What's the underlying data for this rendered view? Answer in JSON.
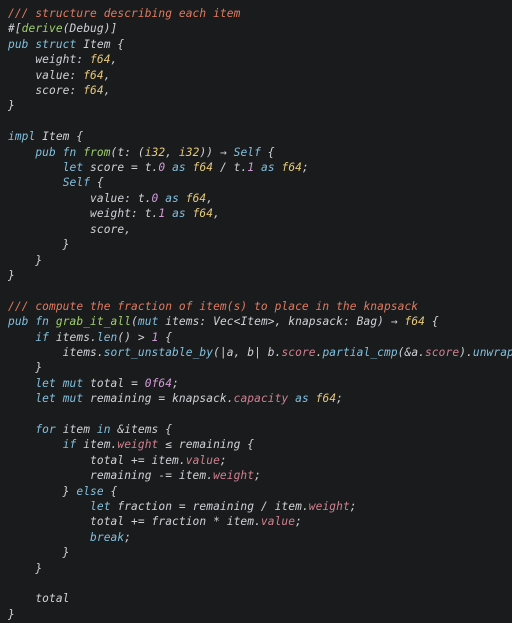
{
  "code": {
    "l1": "/// structure describing each item",
    "l2a": "#[",
    "l2b": "derive",
    "l2c": "(Debug)]",
    "l3a": "pub struct",
    "l3b": " Item {",
    "l4a": "    weight: ",
    "l4b": "f64",
    "l4c": ",",
    "l5a": "    value: ",
    "l5b": "f64",
    "l5c": ",",
    "l6a": "    score: ",
    "l6b": "f64",
    "l6c": ",",
    "l7": "}",
    "l8": "",
    "l9a": "impl",
    "l9b": " Item {",
    "l10a": "    ",
    "l10b": "pub fn",
    "l10c": " ",
    "l10d": "from",
    "l10e": "(t: (",
    "l10f": "i32",
    "l10g": ", ",
    "l10h": "i32",
    "l10i": ")) → ",
    "l10j": "Self",
    "l10k": " {",
    "l11a": "        ",
    "l11b": "let",
    "l11c": " score = t.",
    "l11d": "0",
    "l11e": " ",
    "l11f": "as",
    "l11g": " ",
    "l11h": "f64",
    "l11i": " / t.",
    "l11j": "1",
    "l11k": " ",
    "l11l": "as",
    "l11m": " ",
    "l11n": "f64",
    "l11o": ";",
    "l12a": "        ",
    "l12b": "Self",
    "l12c": " {",
    "l13a": "            value: t.",
    "l13b": "0",
    "l13c": " ",
    "l13d": "as",
    "l13e": " ",
    "l13f": "f64",
    "l13g": ",",
    "l14a": "            weight: t.",
    "l14b": "1",
    "l14c": " ",
    "l14d": "as",
    "l14e": " ",
    "l14f": "f64",
    "l14g": ",",
    "l15": "            score,",
    "l16": "        }",
    "l17": "    }",
    "l18": "}",
    "l19": "",
    "l20": "/// compute the fraction of item(s) to place in the knapsack",
    "l21a": "pub fn",
    "l21b": " ",
    "l21c": "grab_it_all",
    "l21d": "(",
    "l21e": "mut",
    "l21f": " items: Vec<Item>, knapsack: Bag) → ",
    "l21g": "f64",
    "l21h": " {",
    "l22a": "    ",
    "l22b": "if",
    "l22c": " items.",
    "l22d": "len",
    "l22e": "() > ",
    "l22f": "1",
    "l22g": " {",
    "l23a": "        items.",
    "l23b": "sort_unstable_by",
    "l23c": "(|a, b| b.",
    "l23d": "score",
    "l23e": ".",
    "l23f": "partial_cmp",
    "l23g": "(&a.",
    "l23h": "score",
    "l23i": ").",
    "l23j": "unwrap",
    "l23k": "());",
    "l24": "    }",
    "l25a": "    ",
    "l25b": "let",
    "l25c": " ",
    "l25d": "mut",
    "l25e": " total = ",
    "l25f": "0f64",
    "l25g": ";",
    "l26a": "    ",
    "l26b": "let",
    "l26c": " ",
    "l26d": "mut",
    "l26e": " remaining = knapsack.",
    "l26f": "capacity",
    "l26g": " ",
    "l26h": "as",
    "l26i": " ",
    "l26j": "f64",
    "l26k": ";",
    "l27": "",
    "l28a": "    ",
    "l28b": "for",
    "l28c": " item ",
    "l28d": "in",
    "l28e": " &items {",
    "l29a": "        ",
    "l29b": "if",
    "l29c": " item.",
    "l29d": "weight",
    "l29e": " ≤ remaining {",
    "l30a": "            total += item.",
    "l30b": "value",
    "l30c": ";",
    "l31a": "            remaining -= item.",
    "l31b": "weight",
    "l31c": ";",
    "l32a": "        } ",
    "l32b": "else",
    "l32c": " {",
    "l33a": "            ",
    "l33b": "let",
    "l33c": " fraction = remaining / item.",
    "l33d": "weight",
    "l33e": ";",
    "l34a": "            total += fraction * item.",
    "l34b": "value",
    "l34c": ";",
    "l35a": "            ",
    "l35b": "break",
    "l35c": ";",
    "l36": "        }",
    "l37": "    }",
    "l38": "",
    "l39": "    total",
    "l40": "}"
  }
}
